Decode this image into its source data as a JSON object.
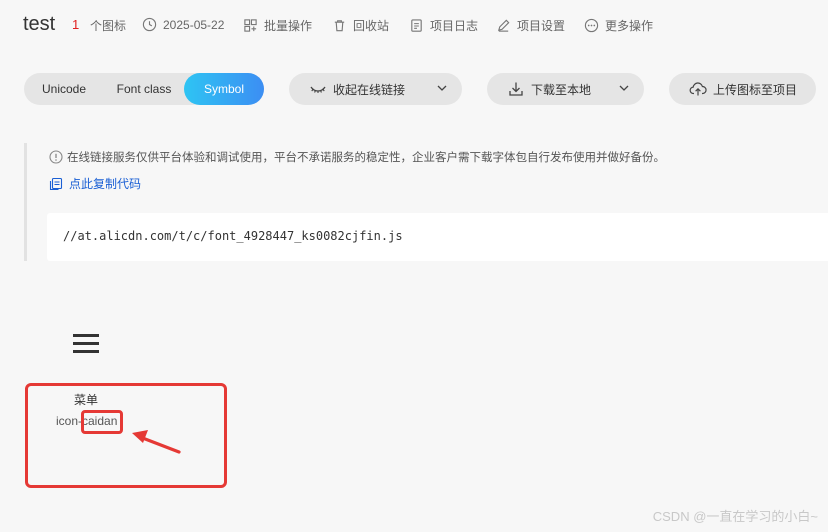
{
  "header": {
    "title": "test",
    "icon_count": "1",
    "icon_count_label": "个图标",
    "date": "2025-05-22",
    "batch": "批量操作",
    "recycle": "回收站",
    "log": "项目日志",
    "settings": "项目设置",
    "more": "更多操作"
  },
  "tabs": {
    "unicode": "Unicode",
    "fontclass": "Font class",
    "symbol": "Symbol",
    "active": "Symbol"
  },
  "toolbar": {
    "online": "收起在线链接",
    "download": "下载至本地",
    "upload": "上传图标至项目"
  },
  "panel": {
    "notice": "在线链接服务仅供平台体验和调试使用，平台不承诺服务的稳定性，企业客户需下载字体包自行发布使用并做好备份。",
    "copy": "点此复制代码",
    "url": "//at.alicdn.com/t/c/font_4928447_ks0082cjfin.js"
  },
  "icon_card": {
    "name": "菜单",
    "code": "icon-caidan"
  },
  "watermark": "CSDN @一直在学习的小白~",
  "colors": {
    "accent_start": "#2ec4f3",
    "accent_end": "#3c8ef3",
    "count": "#e02020",
    "link": "#1a5fd4",
    "annotation": "#e53935"
  }
}
